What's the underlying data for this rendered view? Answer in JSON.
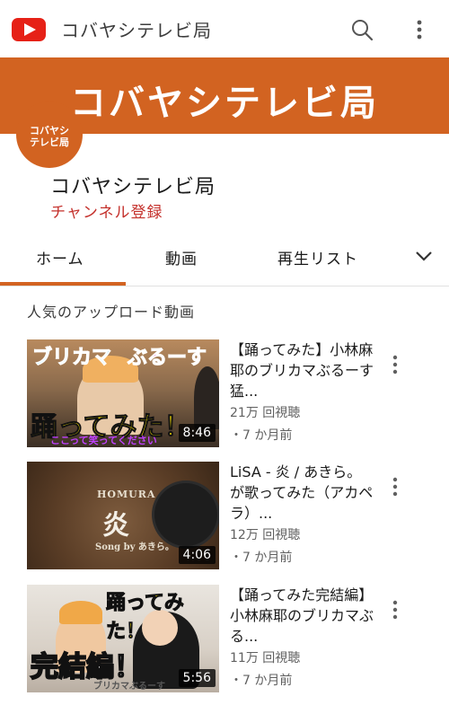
{
  "app": {
    "title": "コバヤシテレビ局"
  },
  "header": {
    "icons": [
      "youtube-logo",
      "search-icon",
      "more-vert-icon"
    ]
  },
  "banner": {
    "text": "コバヤシテレビ局"
  },
  "avatar": {
    "line1": "コバヤシ",
    "line2": "テレビ局"
  },
  "channel": {
    "name": "コバヤシテレビ局",
    "subscribe_label": "チャンネル登録"
  },
  "tabs": [
    {
      "label": "ホーム",
      "selected": true
    },
    {
      "label": "動画",
      "selected": false
    },
    {
      "label": "再生リスト",
      "selected": false
    }
  ],
  "section": {
    "title": "人気のアップロード動画"
  },
  "videos": [
    {
      "title": "【踊ってみた】小林麻耶のブリカマぶるーす猛...",
      "views": "21万 回視聴",
      "date": "・7 か月前",
      "duration": "8:46",
      "art": {
        "a": "ブリカマ",
        "b": "ぶるーす",
        "c": "踊ってみた！",
        "d": "ここって笑ってください"
      }
    },
    {
      "title": "LiSA - 炎 / あきら。が歌ってみた（アカペラ）...",
      "views": "12万 回視聴",
      "date": "・7 か月前",
      "duration": "4:06",
      "art": {
        "a": "HOMURA",
        "b": "炎",
        "c": "Song by あきら。"
      }
    },
    {
      "title": "【踊ってみた完結編】小林麻耶のブリカマぶる...",
      "views": "11万 回視聴",
      "date": "・7 か月前",
      "duration": "5:56",
      "art": {
        "a": "踊ってみた！",
        "b": "完結編！",
        "c": "ブリカマぶるーす"
      }
    }
  ],
  "colors": {
    "accent": "#d26321",
    "youtube_red": "#e62117",
    "subscribe_red": "#c4302b"
  }
}
